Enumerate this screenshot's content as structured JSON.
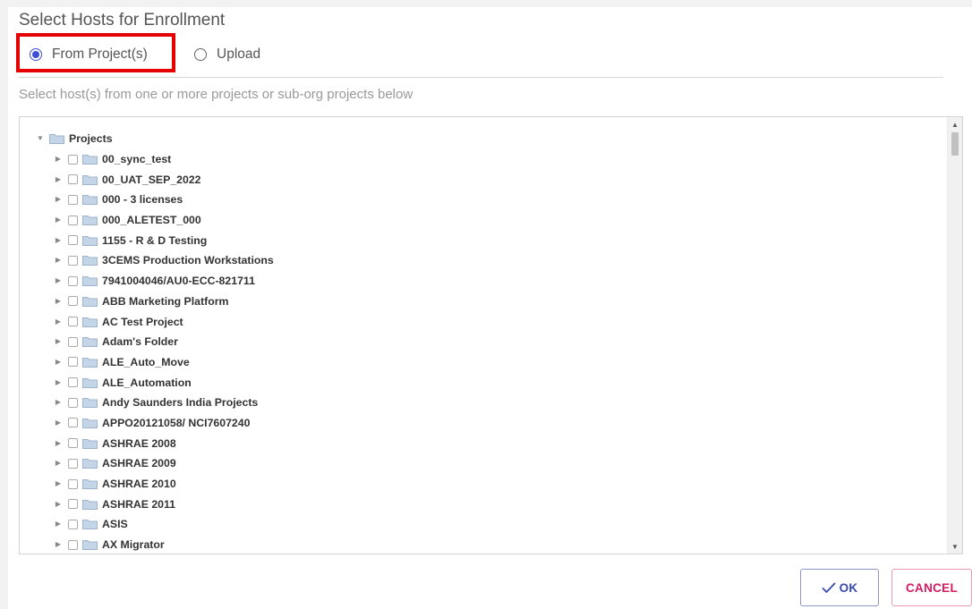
{
  "dialog": {
    "title": "Select Hosts for Enrollment",
    "source_options": [
      {
        "label": "From Project(s)",
        "selected": true
      },
      {
        "label": "Upload",
        "selected": false
      }
    ],
    "hint": "Select host(s) from one or more projects or sub-org projects below"
  },
  "tree": {
    "root": {
      "label": "Projects",
      "expanded": true
    },
    "children": [
      "00_sync_test",
      "00_UAT_SEP_2022",
      "000 - 3 licenses",
      "000_ALETEST_000",
      "1155 - R & D Testing",
      "3CEMS Production Workstations",
      "7941004046/AU0-ECC-821711",
      "ABB Marketing Platform",
      "AC Test Project",
      "Adam's Folder",
      "ALE_Auto_Move",
      "ALE_Automation",
      "Andy Saunders India Projects",
      "APPO20121058/ NCI7607240",
      "ASHRAE 2008",
      "ASHRAE 2009",
      "ASHRAE 2010",
      "ASHRAE 2011",
      "ASIS",
      "AX Migrator"
    ]
  },
  "buttons": {
    "ok": "OK",
    "cancel": "CANCEL"
  },
  "colors": {
    "accent": "#3d4fd0",
    "highlight": "#e60000",
    "ok": "#3949ab",
    "cancel": "#d81b60",
    "folder": "#c5d5e8"
  }
}
